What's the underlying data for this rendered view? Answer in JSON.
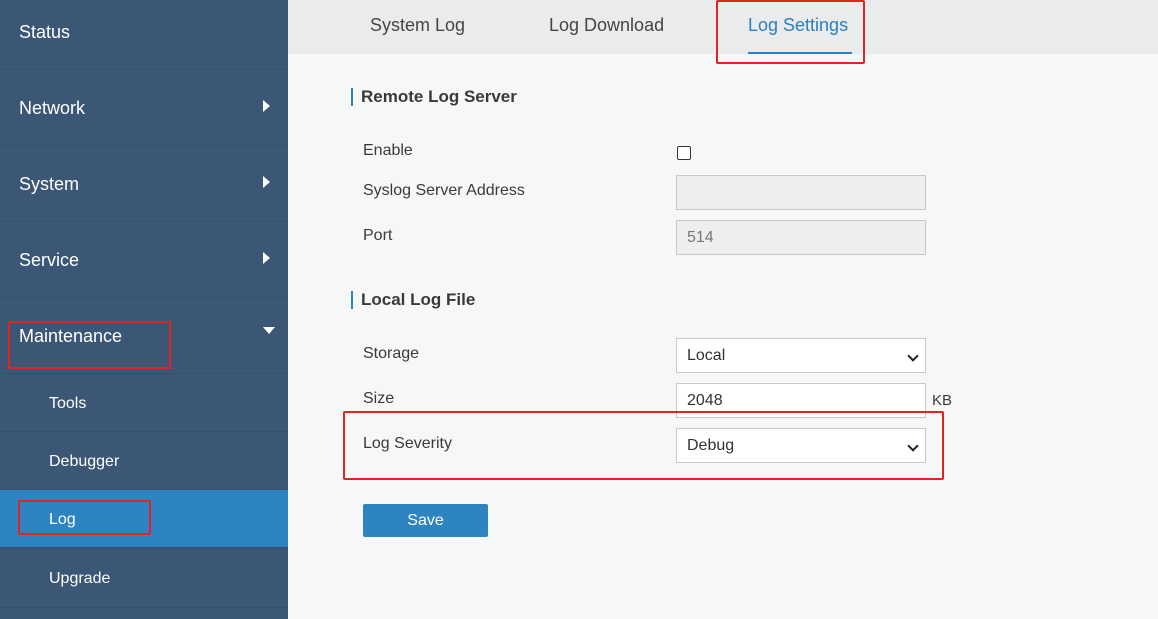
{
  "sidebar": {
    "items": [
      {
        "label": "Status"
      },
      {
        "label": "Network"
      },
      {
        "label": "System"
      },
      {
        "label": "Service"
      },
      {
        "label": "Maintenance"
      }
    ],
    "subitems": [
      {
        "label": "Tools"
      },
      {
        "label": "Debugger"
      },
      {
        "label": "Log"
      },
      {
        "label": "Upgrade"
      }
    ]
  },
  "tabs": [
    {
      "label": "System Log"
    },
    {
      "label": "Log Download"
    },
    {
      "label": "Log Settings"
    }
  ],
  "remote": {
    "title": "Remote Log Server",
    "enable_label": "Enable",
    "address_label": "Syslog Server Address",
    "address_value": "",
    "port_label": "Port",
    "port_placeholder": "514"
  },
  "local": {
    "title": "Local Log File",
    "storage_label": "Storage",
    "storage_value": "Local",
    "size_label": "Size",
    "size_value": "2048",
    "size_unit": "KB",
    "severity_label": "Log Severity",
    "severity_value": "Debug"
  },
  "save_label": "Save",
  "colors": {
    "sidebar_bg": "#3c5675",
    "active_item": "#2d84c1",
    "accent": "#2c7fc0",
    "highlight": "#e32222"
  }
}
